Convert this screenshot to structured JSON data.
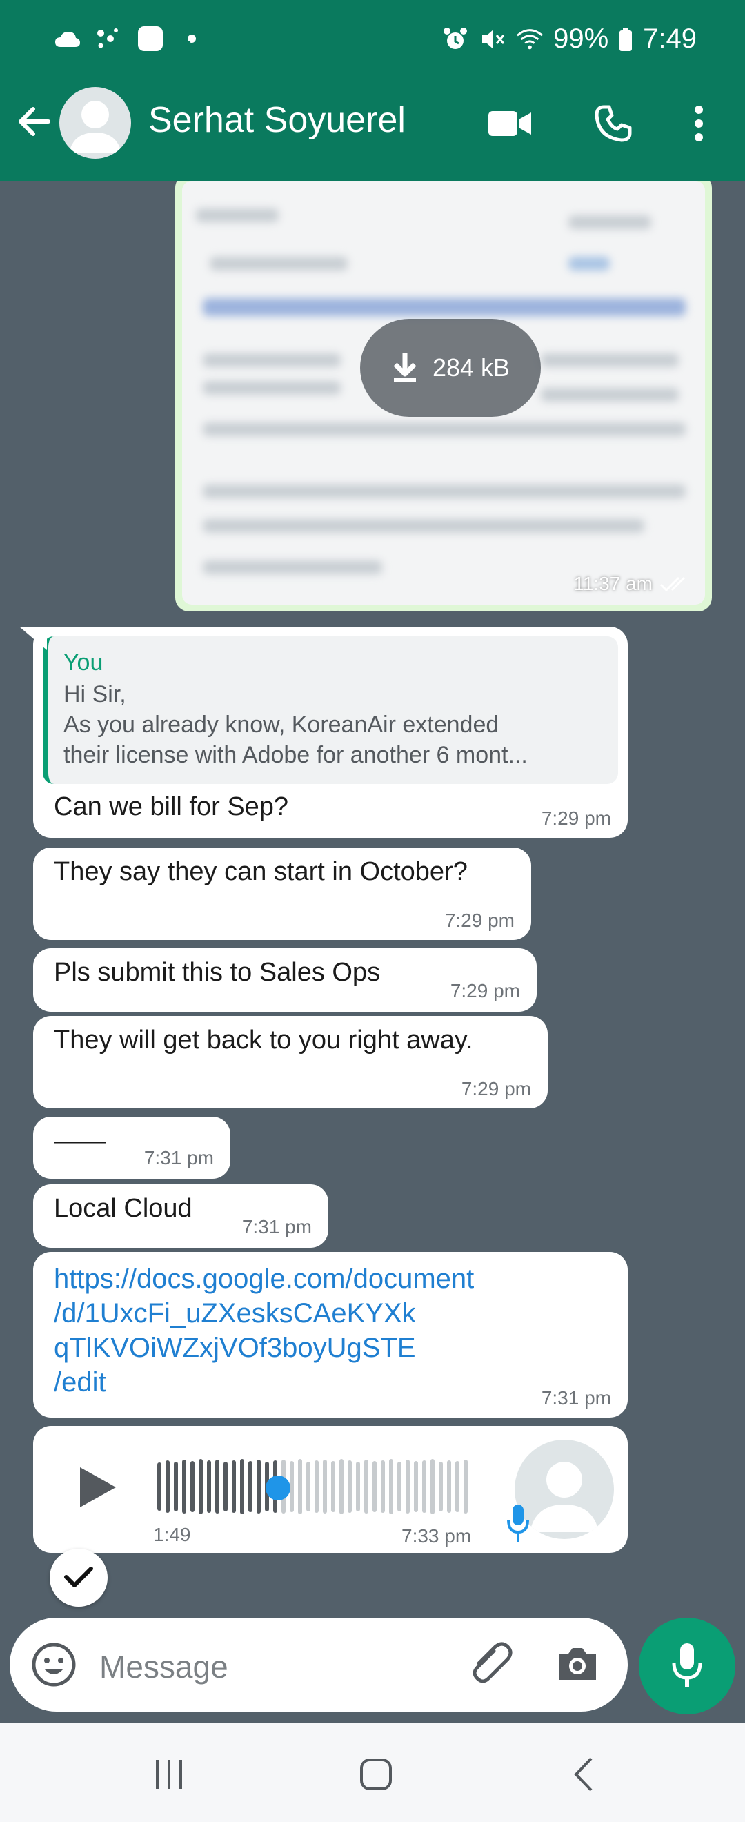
{
  "status_bar": {
    "battery": "99%",
    "time": "7:49",
    "notification_badge": "1"
  },
  "header": {
    "contact_name": "Serhat Soyuerel",
    "icons": [
      "back-arrow-icon",
      "video-call-icon",
      "voice-call-icon",
      "more-options-icon"
    ]
  },
  "colors": {
    "app_bar": "#0a7a5e",
    "chat_background": "#53606a",
    "accent": "#0a9e74",
    "link": "#1f7fd1",
    "outgoing_bubble": "#dff7d6"
  },
  "image_message": {
    "size": "284 kB",
    "time": "11:37 am"
  },
  "messages": [
    {
      "quote_author": "You",
      "quote_line1": "Hi Sir,",
      "quote_line2": "As you already know, KoreanAir extended",
      "quote_line3": "their license with Adobe for another 6 mont...",
      "text": "Can we bill for Sep?",
      "time": "7:29 pm"
    },
    {
      "text": "They say they can start in October?",
      "time": "7:29 pm"
    },
    {
      "text": "Pls submit this to Sales Ops",
      "time": "7:29 pm"
    },
    {
      "text": "They will get back to you right away.",
      "time": "7:29 pm"
    },
    {
      "text": "——",
      "time": "7:31 pm"
    },
    {
      "text": "Local Cloud",
      "time": "7:31 pm"
    },
    {
      "link_line1": "https://docs.google.com/document",
      "link_line2": "/d/1UxcFi_uZXesksCAeKYXk",
      "link_line3": "qTlKVOiWZxjVOf3boyUgSTE",
      "link_line4": "/edit",
      "time": "7:31 pm"
    }
  ],
  "voice_message": {
    "duration": "1:49",
    "time": "7:33 pm",
    "progress": 0.38
  },
  "composer": {
    "placeholder": "Message"
  }
}
